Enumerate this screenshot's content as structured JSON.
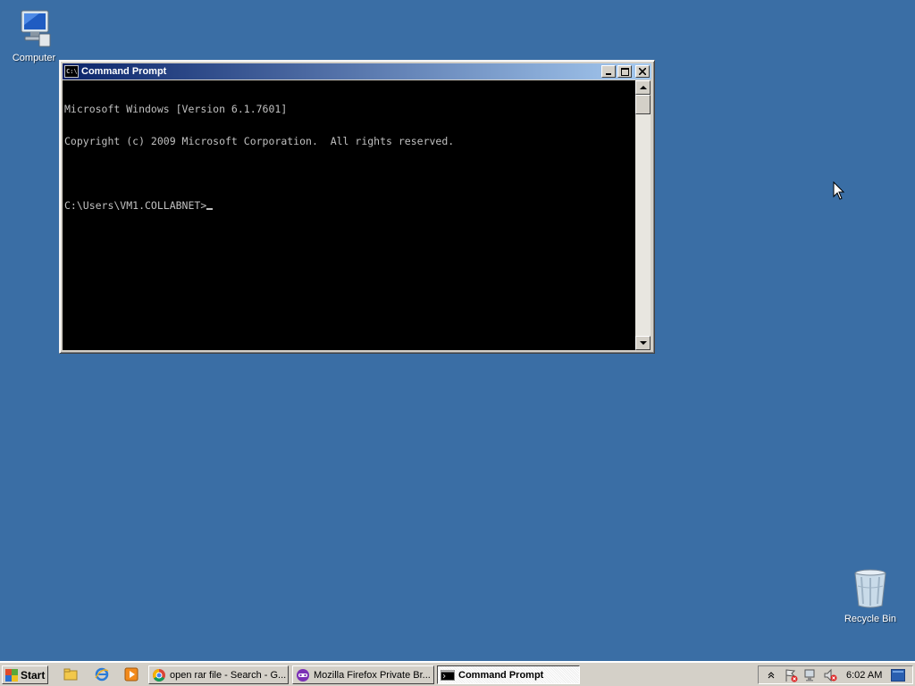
{
  "desktop": {
    "icons": [
      {
        "label": "Computer"
      },
      {
        "label": "Recycle Bin"
      }
    ]
  },
  "window": {
    "title": "Command Prompt",
    "icon_text": "C:\\",
    "console_lines": [
      "Microsoft Windows [Version 6.1.7601]",
      "Copyright (c) 2009 Microsoft Corporation.  All rights reserved.",
      "",
      "C:\\Users\\VM1.COLLABNET>"
    ]
  },
  "taskbar": {
    "start_label": "Start",
    "tasks": [
      {
        "label": "open rar file - Search - G..."
      },
      {
        "label": "Mozilla Firefox Private Br..."
      },
      {
        "label": "Command Prompt"
      }
    ],
    "clock": "6:02 AM"
  },
  "colors": {
    "desktop": "#3a6ea5",
    "titlebar_start": "#0a246a",
    "titlebar_end": "#a6caf0"
  }
}
